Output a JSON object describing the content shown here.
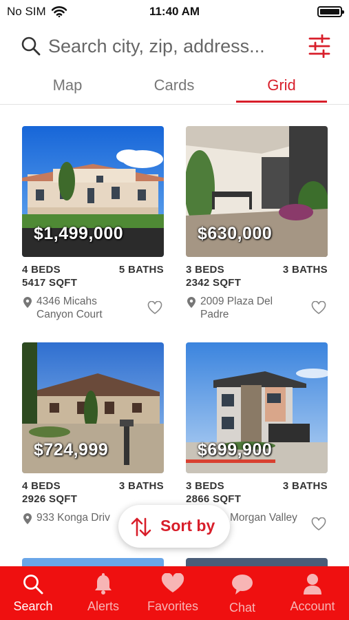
{
  "status_bar": {
    "carrier": "No SIM",
    "time": "11:40 AM",
    "icons": [
      "wifi-icon",
      "battery-icon"
    ]
  },
  "search": {
    "placeholder": "Search city, zip, address...",
    "icons": [
      "search-icon",
      "filter-sliders-icon"
    ]
  },
  "tabs": [
    {
      "label": "Map",
      "active": false
    },
    {
      "label": "Cards",
      "active": false
    },
    {
      "label": "Grid",
      "active": true
    }
  ],
  "listings": [
    {
      "price": "$1,499,000",
      "beds": "4 BEDS",
      "baths": "5 BATHS",
      "sqft": "5417 SQFT",
      "address": "4346 Micahs Canyon Court"
    },
    {
      "price": "$630,000",
      "beds": "3 BEDS",
      "baths": "3 BATHS",
      "sqft": "2342 SQFT",
      "address": "2009 Plaza Del Padre"
    },
    {
      "price": "$724,999",
      "beds": "4 BEDS",
      "baths": "3 BATHS",
      "sqft": "2926 SQFT",
      "address": "933 Konga Driv"
    },
    {
      "price": "$699,900",
      "beds": "3 BEDS",
      "baths": "3 BATHS",
      "sqft": "2866 SQFT",
      "address": "Morgan Valley"
    }
  ],
  "sort": {
    "label": "Sort by",
    "icon": "sort-arrows-icon"
  },
  "bottom_nav": [
    {
      "label": "Search",
      "icon": "search-icon",
      "active": true
    },
    {
      "label": "Alerts",
      "icon": "bell-icon",
      "active": false
    },
    {
      "label": "Favorites",
      "icon": "heart-icon",
      "active": false
    },
    {
      "label": "Chat",
      "icon": "chat-bubble-icon",
      "active": false
    },
    {
      "label": "Account",
      "icon": "person-icon",
      "active": false
    }
  ],
  "colors": {
    "accent": "#d81e2a",
    "nav_bar": "#ef1010",
    "nav_inactive": "#f7b5b5"
  }
}
